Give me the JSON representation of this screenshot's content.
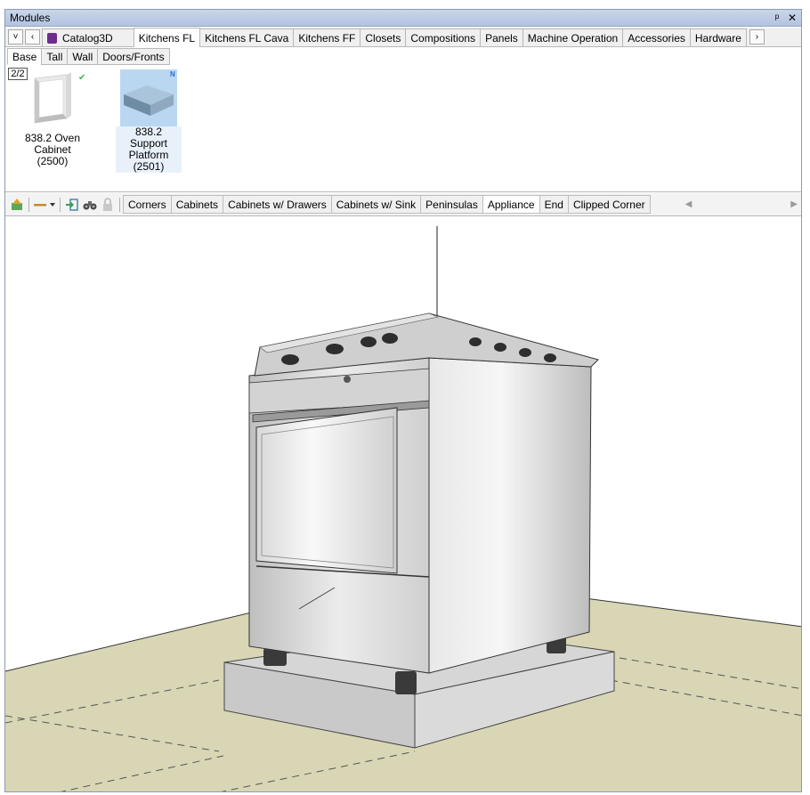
{
  "window": {
    "title": "Modules",
    "pin_icon": "pin-icon",
    "close_icon": "close-icon"
  },
  "nav": {
    "dropdown": "˅",
    "prev": "‹",
    "next": "›"
  },
  "catalog_tabs": [
    {
      "label": "Catalog3D",
      "icon": "catalog-cube-icon"
    },
    {
      "label": "Kitchens FL"
    },
    {
      "label": "Kitchens FL Cava"
    },
    {
      "label": "Kitchens FF"
    },
    {
      "label": "Closets"
    },
    {
      "label": "Compositions"
    },
    {
      "label": "Panels"
    },
    {
      "label": "Machine Operation"
    },
    {
      "label": "Accessories"
    },
    {
      "label": "Hardware"
    }
  ],
  "active_catalog_tab": "Kitchens FL",
  "sub_tabs": [
    "Base",
    "Tall",
    "Wall",
    "Doors/Fronts"
  ],
  "active_sub_tab": "Base",
  "page_indicator": "2/2",
  "items": [
    {
      "label_line1": "838.2 Oven Cabinet",
      "label_line2": "(2500)",
      "badge": "✔",
      "badge_color": "#3db54a",
      "selected": false
    },
    {
      "label_line1": "838.2 Support",
      "label_line2": "Platform (2501)",
      "badge": "N",
      "badge_color": "#2a6fd0",
      "selected": true
    }
  ],
  "toolbar_icons": [
    "up-level-icon",
    "line-style-dropdown-icon",
    "insert-icon",
    "binoculars-icon",
    "lock-icon"
  ],
  "categories": [
    "Corners",
    "Cabinets",
    "Cabinets w/ Drawers",
    "Cabinets w/ Sink",
    "Peninsulas",
    "Appliance",
    "End",
    "Clipped Corner"
  ],
  "active_category": "Appliance",
  "scroll": {
    "left": "◀",
    "right": "▶"
  },
  "colors": {
    "floor": "#d9d6b5",
    "titlebar": "#c3d1e8",
    "selection": "#cce4f7"
  }
}
